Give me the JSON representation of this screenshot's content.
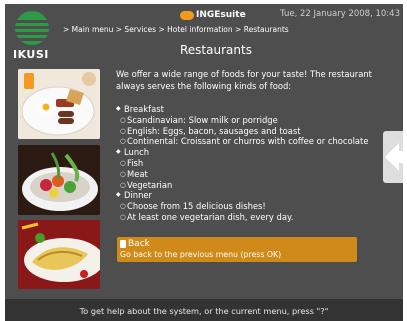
{
  "header": {
    "logo_text": "IKUSI",
    "brand": "INGEsuite",
    "date": "Tue, 22 January 2008, 10:43",
    "breadcrumb": "> Main menu > Services > Hotel information > Restaurants",
    "title": "Restaurants"
  },
  "intro": "We offer a wide range of foods for your taste! The restaurant always serves the following kinds of food:",
  "menu": [
    {
      "type": "category",
      "label": "Breakfast"
    },
    {
      "type": "item",
      "label": "Scandinavian: Slow milk or porridge"
    },
    {
      "type": "item",
      "label": "English: Eggs, bacon, sausages and toast"
    },
    {
      "type": "item",
      "label": "Continental: Croissant or churros with coffee or chocolate"
    },
    {
      "type": "category",
      "label": "Lunch"
    },
    {
      "type": "item",
      "label": "Fish"
    },
    {
      "type": "item",
      "label": "Meat"
    },
    {
      "type": "item",
      "label": "Vegetarian"
    },
    {
      "type": "category",
      "label": "Dinner"
    },
    {
      "type": "item",
      "label": "Choose from 15 delicious dishes!"
    },
    {
      "type": "item",
      "label": "At least one vegetarian dish, every day."
    }
  ],
  "back": {
    "label": "Back",
    "description": "Go back to the previous menu (press OK)"
  },
  "footer": "To get help about the system, or the current menu, press \"?\"",
  "colors": {
    "background": "#4e4e4e",
    "accent": "#d08a1a",
    "logo_green": "#2e9a45",
    "footer_bg": "#333333"
  },
  "icons": [
    "ikusi-logo-icon",
    "ingesuite-logo-icon",
    "back-arrow-icon",
    "next-arrow-icon"
  ]
}
